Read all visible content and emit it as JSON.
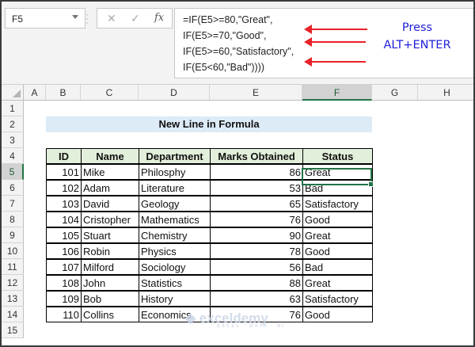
{
  "name_box": "F5",
  "formula_lines": [
    "=IF(E5>=80,\"Great\",",
    "IF(E5>=70,\"Good\",",
    "IF(E5>=60,\"Satisfactory\",",
    "IF(E5<60,\"Bad\"))))"
  ],
  "note": {
    "line1": "Press",
    "line2": "ALT+ENTER"
  },
  "icons": {
    "cancel": "✕",
    "enter": "✓",
    "fx": "fx"
  },
  "columns": [
    "A",
    "B",
    "C",
    "D",
    "E",
    "F",
    "G",
    "H"
  ],
  "rows": [
    "1",
    "2",
    "3",
    "4",
    "5",
    "6",
    "7",
    "8",
    "9",
    "10",
    "11",
    "12",
    "13",
    "14",
    "15"
  ],
  "title": "New Line in Formula",
  "table": {
    "headers": [
      "ID",
      "Name",
      "Department",
      "Marks Obtained",
      "Status"
    ],
    "rows": [
      [
        "101",
        "Mike",
        "Philosphy",
        "86",
        "Great"
      ],
      [
        "102",
        "Adam",
        "Literature",
        "53",
        "Bad"
      ],
      [
        "103",
        "David",
        "Geology",
        "65",
        "Satisfactory"
      ],
      [
        "104",
        "Cristopher",
        "Mathematics",
        "76",
        "Good"
      ],
      [
        "105",
        "Stuart",
        "Chemistry",
        "90",
        "Great"
      ],
      [
        "106",
        "Robin",
        "Physics",
        "78",
        "Good"
      ],
      [
        "107",
        "Milford",
        "Sociology",
        "56",
        "Bad"
      ],
      [
        "108",
        "John",
        "Statistics",
        "88",
        "Great"
      ],
      [
        "109",
        "Bob",
        "History",
        "63",
        "Satisfactory"
      ],
      [
        "110",
        "Collins",
        "Economics",
        "76",
        "Good"
      ]
    ]
  },
  "watermark": "exceldemy",
  "watermark_sub": "EXCEL · DATA · BI",
  "colors": {
    "accent": "#217346",
    "header_fill": "#e2efda",
    "title_fill": "#ddebf7",
    "arrow": "#e8232a",
    "note": "#1f1fd8"
  }
}
